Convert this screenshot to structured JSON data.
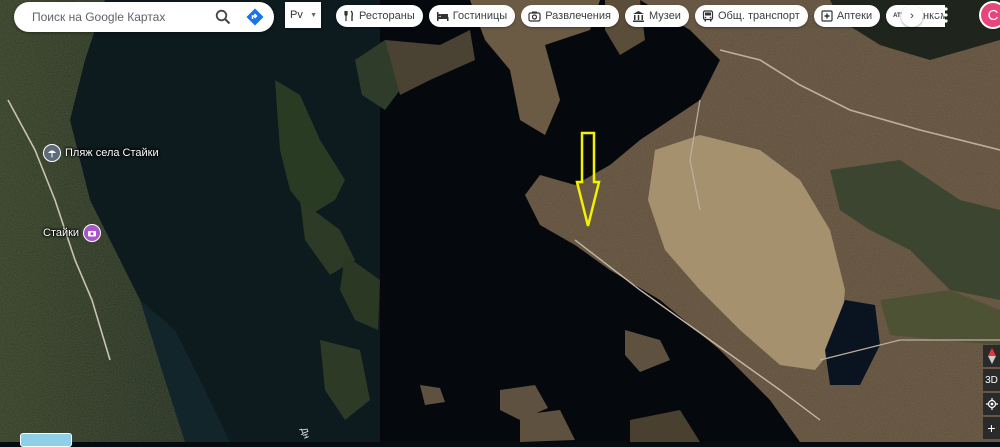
{
  "search": {
    "placeholder": "Поиск на Google Картах",
    "search_icon": "search-icon",
    "directions_icon": "directions-icon"
  },
  "language": {
    "label": "Рv"
  },
  "chips": [
    {
      "label": "Рестораны",
      "icon": "restaurant-icon"
    },
    {
      "label": "Гостиницы",
      "icon": "hotel-icon"
    },
    {
      "label": "Развлечения",
      "icon": "camera-icon"
    },
    {
      "label": "Музеи",
      "icon": "museum-icon"
    },
    {
      "label": "Общ. транспорт",
      "icon": "bus-icon"
    },
    {
      "label": "Аптеки",
      "icon": "pharmacy-icon"
    },
    {
      "label": "Банкома",
      "icon": "atm-icon"
    }
  ],
  "atm_badge": "ATM",
  "user": {
    "avatar_letter": "С"
  },
  "places": [
    {
      "label": "Пляж села Стайки",
      "icon": "beach-icon",
      "color": "#5e6b78"
    },
    {
      "label": "Стайки",
      "icon": "camera-icon",
      "color": "#a855c8"
    }
  ],
  "map_controls": {
    "threed_label": "3D",
    "zoom_in": "+"
  },
  "street_text": "Дн",
  "colors": {
    "water": "#060b10",
    "annotation_arrow": "#f2f200",
    "avatar": "#e8457d"
  }
}
